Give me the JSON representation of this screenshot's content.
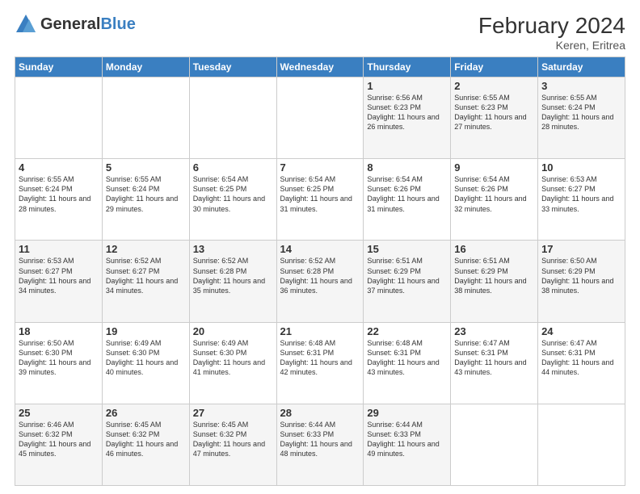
{
  "header": {
    "logo_general": "General",
    "logo_blue": "Blue",
    "month_year": "February 2024",
    "location": "Keren, Eritrea"
  },
  "days_of_week": [
    "Sunday",
    "Monday",
    "Tuesday",
    "Wednesday",
    "Thursday",
    "Friday",
    "Saturday"
  ],
  "weeks": [
    [
      {
        "day": "",
        "info": ""
      },
      {
        "day": "",
        "info": ""
      },
      {
        "day": "",
        "info": ""
      },
      {
        "day": "",
        "info": ""
      },
      {
        "day": "1",
        "info": "Sunrise: 6:56 AM\nSunset: 6:23 PM\nDaylight: 11 hours and 26 minutes."
      },
      {
        "day": "2",
        "info": "Sunrise: 6:55 AM\nSunset: 6:23 PM\nDaylight: 11 hours and 27 minutes."
      },
      {
        "day": "3",
        "info": "Sunrise: 6:55 AM\nSunset: 6:24 PM\nDaylight: 11 hours and 28 minutes."
      }
    ],
    [
      {
        "day": "4",
        "info": "Sunrise: 6:55 AM\nSunset: 6:24 PM\nDaylight: 11 hours and 28 minutes."
      },
      {
        "day": "5",
        "info": "Sunrise: 6:55 AM\nSunset: 6:24 PM\nDaylight: 11 hours and 29 minutes."
      },
      {
        "day": "6",
        "info": "Sunrise: 6:54 AM\nSunset: 6:25 PM\nDaylight: 11 hours and 30 minutes."
      },
      {
        "day": "7",
        "info": "Sunrise: 6:54 AM\nSunset: 6:25 PM\nDaylight: 11 hours and 31 minutes."
      },
      {
        "day": "8",
        "info": "Sunrise: 6:54 AM\nSunset: 6:26 PM\nDaylight: 11 hours and 31 minutes."
      },
      {
        "day": "9",
        "info": "Sunrise: 6:54 AM\nSunset: 6:26 PM\nDaylight: 11 hours and 32 minutes."
      },
      {
        "day": "10",
        "info": "Sunrise: 6:53 AM\nSunset: 6:27 PM\nDaylight: 11 hours and 33 minutes."
      }
    ],
    [
      {
        "day": "11",
        "info": "Sunrise: 6:53 AM\nSunset: 6:27 PM\nDaylight: 11 hours and 34 minutes."
      },
      {
        "day": "12",
        "info": "Sunrise: 6:52 AM\nSunset: 6:27 PM\nDaylight: 11 hours and 34 minutes."
      },
      {
        "day": "13",
        "info": "Sunrise: 6:52 AM\nSunset: 6:28 PM\nDaylight: 11 hours and 35 minutes."
      },
      {
        "day": "14",
        "info": "Sunrise: 6:52 AM\nSunset: 6:28 PM\nDaylight: 11 hours and 36 minutes."
      },
      {
        "day": "15",
        "info": "Sunrise: 6:51 AM\nSunset: 6:29 PM\nDaylight: 11 hours and 37 minutes."
      },
      {
        "day": "16",
        "info": "Sunrise: 6:51 AM\nSunset: 6:29 PM\nDaylight: 11 hours and 38 minutes."
      },
      {
        "day": "17",
        "info": "Sunrise: 6:50 AM\nSunset: 6:29 PM\nDaylight: 11 hours and 38 minutes."
      }
    ],
    [
      {
        "day": "18",
        "info": "Sunrise: 6:50 AM\nSunset: 6:30 PM\nDaylight: 11 hours and 39 minutes."
      },
      {
        "day": "19",
        "info": "Sunrise: 6:49 AM\nSunset: 6:30 PM\nDaylight: 11 hours and 40 minutes."
      },
      {
        "day": "20",
        "info": "Sunrise: 6:49 AM\nSunset: 6:30 PM\nDaylight: 11 hours and 41 minutes."
      },
      {
        "day": "21",
        "info": "Sunrise: 6:48 AM\nSunset: 6:31 PM\nDaylight: 11 hours and 42 minutes."
      },
      {
        "day": "22",
        "info": "Sunrise: 6:48 AM\nSunset: 6:31 PM\nDaylight: 11 hours and 43 minutes."
      },
      {
        "day": "23",
        "info": "Sunrise: 6:47 AM\nSunset: 6:31 PM\nDaylight: 11 hours and 43 minutes."
      },
      {
        "day": "24",
        "info": "Sunrise: 6:47 AM\nSunset: 6:31 PM\nDaylight: 11 hours and 44 minutes."
      }
    ],
    [
      {
        "day": "25",
        "info": "Sunrise: 6:46 AM\nSunset: 6:32 PM\nDaylight: 11 hours and 45 minutes."
      },
      {
        "day": "26",
        "info": "Sunrise: 6:45 AM\nSunset: 6:32 PM\nDaylight: 11 hours and 46 minutes."
      },
      {
        "day": "27",
        "info": "Sunrise: 6:45 AM\nSunset: 6:32 PM\nDaylight: 11 hours and 47 minutes."
      },
      {
        "day": "28",
        "info": "Sunrise: 6:44 AM\nSunset: 6:33 PM\nDaylight: 11 hours and 48 minutes."
      },
      {
        "day": "29",
        "info": "Sunrise: 6:44 AM\nSunset: 6:33 PM\nDaylight: 11 hours and 49 minutes."
      },
      {
        "day": "",
        "info": ""
      },
      {
        "day": "",
        "info": ""
      }
    ]
  ]
}
